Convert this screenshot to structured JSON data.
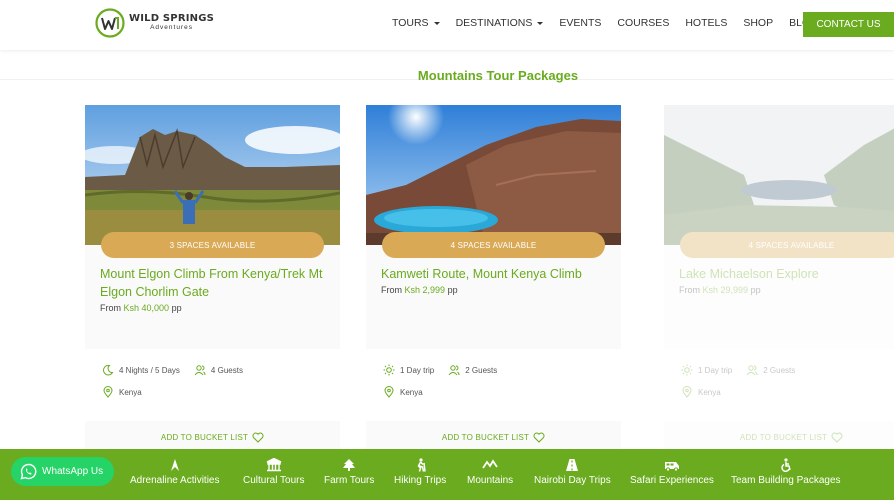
{
  "brand": {
    "name": "WILD SPRINGS",
    "sub": "Adventures"
  },
  "nav": {
    "items": [
      {
        "label": "TOURS",
        "dropdown": true
      },
      {
        "label": "DESTINATIONS",
        "dropdown": true
      },
      {
        "label": "EVENTS",
        "dropdown": false
      },
      {
        "label": "COURSES",
        "dropdown": false
      },
      {
        "label": "HOTELS",
        "dropdown": false
      },
      {
        "label": "SHOP",
        "dropdown": false
      },
      {
        "label": "BLOG",
        "dropdown": false
      }
    ],
    "contact_label": "CONTACT US"
  },
  "section": {
    "title": "Mountains Tour Packages"
  },
  "cards": [
    {
      "badge": "3 SPACES AVAILABLE",
      "title": "Mount Elgon Climb From Kenya/Trek Mt Elgon Chorlim Gate",
      "price_prefix": "From",
      "price": "Ksh 40,000",
      "price_suffix": "pp",
      "duration": "4 Nights /  5 Days",
      "guests": "4 Guests",
      "location": "Kenya",
      "cta": "ADD TO BUCKET LIST"
    },
    {
      "badge": "4 SPACES AVAILABLE",
      "title": "Kamweti Route, Mount Kenya Climb",
      "price_prefix": "From",
      "price": "Ksh 2,999",
      "price_suffix": "pp",
      "duration": "1 Day trip",
      "guests": "2 Guests",
      "location": "Kenya",
      "cta": "ADD TO BUCKET LIST"
    },
    {
      "badge": "4 SPACES AVAILABLE",
      "title": "Lake Michaelson Explore",
      "price_prefix": "From",
      "price": "Ksh 29,999",
      "price_suffix": "pp",
      "duration": "1 Day trip",
      "guests": "2 Guests",
      "location": "Kenya",
      "cta": "ADD TO BUCKET LIST"
    }
  ],
  "footer": {
    "whatsapp_label": "WhatsApp Us",
    "categories": [
      {
        "label": "Adrenaline Activities",
        "icon": "adrenaline-icon"
      },
      {
        "label": "Cultural Tours",
        "icon": "cultural-icon"
      },
      {
        "label": "Farm Tours",
        "icon": "farm-icon"
      },
      {
        "label": "Hiking Trips",
        "icon": "hiking-icon"
      },
      {
        "label": "Mountains",
        "icon": "mountains-icon"
      },
      {
        "label": "Nairobi Day Trips",
        "icon": "road-icon"
      },
      {
        "label": "Safari Experiences",
        "icon": "safari-van-icon"
      },
      {
        "label": "Team Building Packages",
        "icon": "team-icon"
      }
    ]
  },
  "colors": {
    "accent": "#6aab1f",
    "badge": "#d9a955",
    "whatsapp": "#25d366"
  }
}
